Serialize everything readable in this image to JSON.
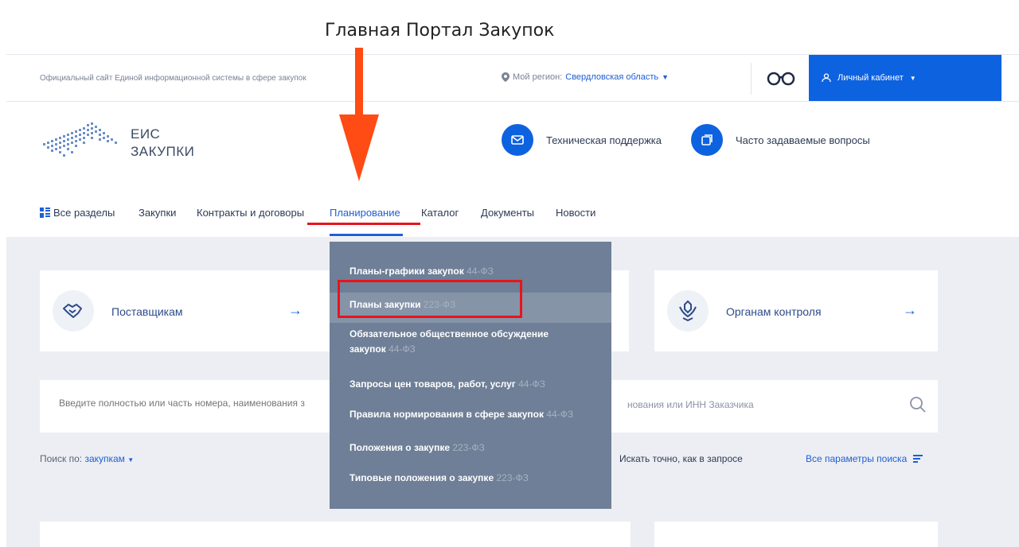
{
  "caption": "Главная Портал Закупок",
  "topbar": {
    "site_description": "Официальный сайт Единой информационной системы в сфере закупок",
    "region_label": "Мой регион:",
    "region_value": "Свердловская область",
    "cabinet_label": "Личный кабинет"
  },
  "header": {
    "logo_line1": "ЕИС",
    "logo_line2": "ЗАКУПКИ",
    "support_label": "Техническая поддержка",
    "faq_label": "Часто задаваемые вопросы"
  },
  "nav": {
    "all_sections": "Все разделы",
    "items": [
      "Закупки",
      "Контракты и договоры",
      "Планирование",
      "Каталог",
      "Документы",
      "Новости"
    ],
    "active_index": 2
  },
  "cards": {
    "suppliers": "Поставщикам",
    "control": "Органам контроля"
  },
  "search": {
    "placeholder": "Введите полностью или часть номера, наименования з",
    "placeholder_tail": "нования или ИНН Заказчика",
    "by_label": "Поиск по:",
    "by_value": "закупкам",
    "exact_label": "Искать точно, как в запросе",
    "all_params": "Все параметры поиска"
  },
  "dropdown": {
    "items": [
      {
        "label": "Планы-графики закупок",
        "law": "44-ФЗ"
      },
      {
        "label": "Планы закупки",
        "law": "223-ФЗ"
      },
      {
        "label": "Обязательное общественное обсуждение закупок",
        "law": "44-ФЗ"
      },
      {
        "label": "Запросы цен товаров, работ, услуг",
        "law": "44-ФЗ"
      },
      {
        "label": "Правила нормирования в сфере закупок",
        "law": "44-ФЗ"
      },
      {
        "label": "Положения о закупке",
        "law": "223-ФЗ"
      },
      {
        "label": "Типовые положения о закупке",
        "law": "223-ФЗ"
      }
    ],
    "highlighted_index": 1
  },
  "colors": {
    "accent": "#0d62e0",
    "annotation_red": "#e8141b",
    "annotation_orange": "#ff4b14",
    "dropdown_bg": "#6e7f97"
  }
}
